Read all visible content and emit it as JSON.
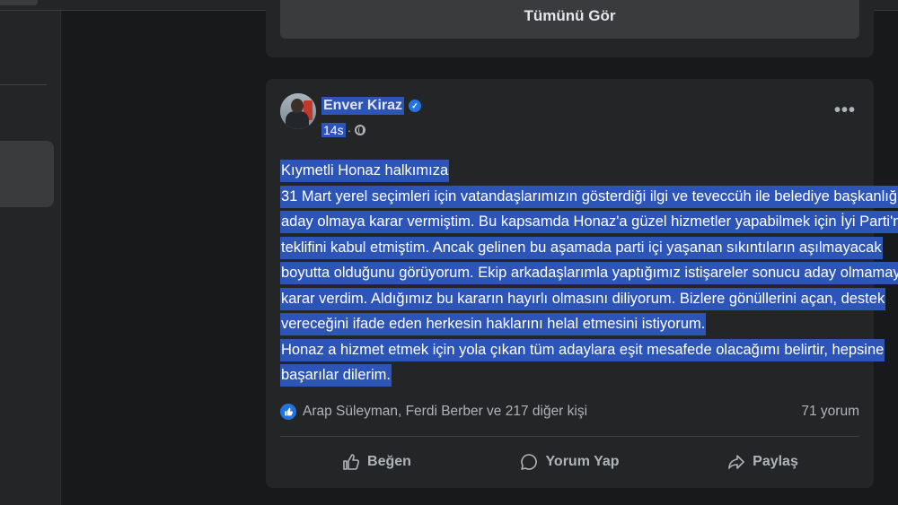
{
  "previous_card": {
    "see_all_label": "Tümünü Gör"
  },
  "post": {
    "author": "Enver Kiraz",
    "time": "14s",
    "meta_dot": "·",
    "more_label": "•••",
    "text_lines": [
      "Kıymetli Honaz halkımıza",
      "31 Mart yerel seçimleri için vatandaşlarımızın gösterdiği ilgi ve teveccüh ile belediye başkanlığına",
      "aday olmaya karar vermiştim. Bu kapsamda Honaz'a güzel hizmetler yapabilmek için İyi Parti'nin",
      "teklifini kabul etmiştim. Ancak gelinen bu aşamada parti içi yaşanan sıkıntıların aşılmayacak",
      "boyutta olduğunu görüyorum. Ekip arkadaşlarımla yaptığımız istişareler sonucu aday olmamaya",
      "karar verdim. Aldığımız bu kararın hayırlı olmasını diliyorum. Bizlere gönüllerini açan, destek",
      "vereceğini ifade eden herkesin haklarını helal etmesini istiyorum.",
      "Honaz a hizmet etmek için yola çıkan tüm adaylara eşit mesafede olacağımı belirtir, hepsine",
      "başarılar dilerim."
    ],
    "reactions_text": "Arap Süleyman, Ferdi Berber ve 217 diğer kişi",
    "comments_count": "71 yorum",
    "actions": {
      "like": "Beğen",
      "comment": "Yorum Yap",
      "share": "Paylaş"
    }
  },
  "colors": {
    "background": "#18191a",
    "card": "#242526",
    "selection": "#2d55b8",
    "accent": "#2374e1"
  }
}
